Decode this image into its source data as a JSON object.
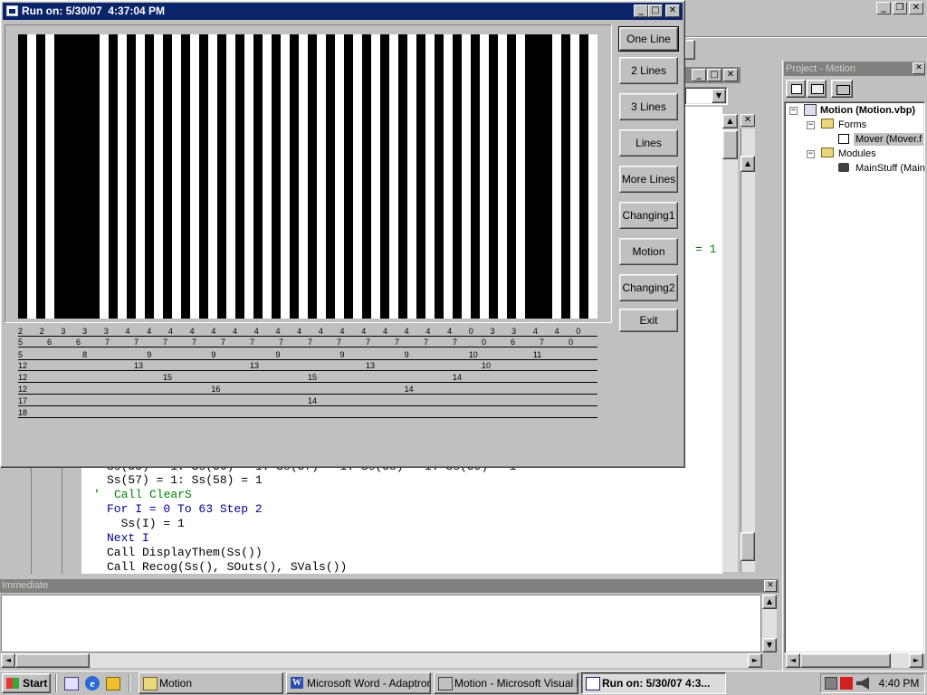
{
  "vb_toolbar_right": {
    "min": "_",
    "max": "❐",
    "close": "✕"
  },
  "project_panel": {
    "title": "Project - Motion",
    "tree": {
      "root": "Motion (Motion.vbp)",
      "forms_folder": "Forms",
      "form_item": "Mover (Mover.f",
      "modules_folder": "Modules",
      "module_item": "MainStuff (Main"
    }
  },
  "code_window": {
    "lines": [
      "Ss(57) = 1: Ss(58) = 1",
      "' Call ClearS",
      "For I = 0 To 63 Step 2",
      "  Ss(I) = 1",
      "Next I",
      "Call DisplayThem(Ss())",
      "Call Recog(Ss(), SOuts(), SVals())"
    ],
    "partial_line_top": "Ss(55) = 1: Ss(56) = 1: Ss(57) = 1: Ss(58) = 1: Ss(59) = 1",
    "stray_fragment": "= 1",
    "stray_fragment2": "= 1"
  },
  "immediate": {
    "title": "Immediate"
  },
  "run_window": {
    "title": "Run on: 5/30/07  4:37:04 PM",
    "buttons": [
      "One Line",
      "2 Lines",
      "3 Lines",
      "Lines",
      "More Lines",
      "Changing1",
      "Motion",
      "Changing2",
      "Exit"
    ],
    "rows": [
      "2 2 3 3 3 4 4 4 4 4 4 4 4 4 4 4 4 4 4 4 4 0 3 3 4 4 0",
      "5 6 6 7 7 7 7 7 7 7 7 7 7 7 7 7 0 6 7 0",
      "5 8 9 9 9 9 9 10 11",
      "12 13 13 13 10",
      "12 15 15 14",
      "12 16 14",
      "17 14",
      "18"
    ]
  },
  "taskbar": {
    "start": "Start",
    "tasks": [
      "Motion",
      "Microsoft Word - Adaptron ...",
      "Motion - Microsoft Visual B...",
      "Run on: 5/30/07  4:3..."
    ],
    "clock": "4:40 PM"
  },
  "colors": {
    "title_active": "#0a246a",
    "title_inactive": "#808080",
    "face": "#c0c0c0",
    "desktop": "#808080"
  }
}
